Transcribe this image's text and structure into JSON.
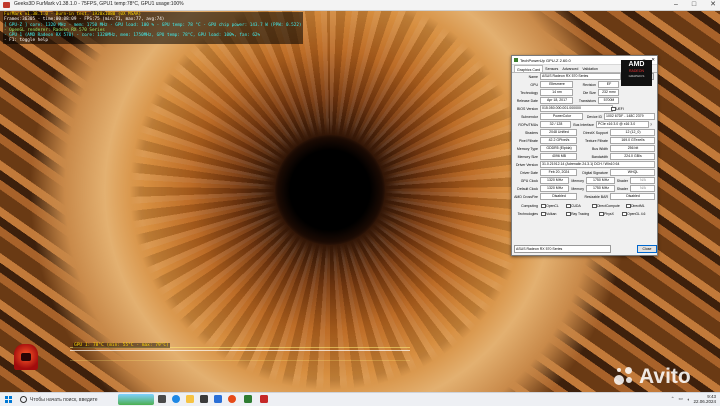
{
  "window_title": "Geeks3D FurMark v1.38.1.0 - 75FPS, GPU1 temp:78°C, GPU1 usage:100%",
  "window_controls": [
    "–",
    "□",
    "✕"
  ],
  "osd": [
    {
      "text": "FurMark v1.38.1.0 - Burn-in test, 1920x1080 (0X MSAA)",
      "color": "yellow"
    },
    {
      "text": "Frames:36305 - time:00:08:09 - FPS:75 (min:71, max:77, avg:74)",
      "color": "white"
    },
    {
      "text": "[ GPU-Z ] core: 1320 MHz - mem: 1750 MHz - GPU load: 100 % - GPU temp: 78 °C - GPU chip power: 143.7 W (PPW: 0.522)",
      "color": "cyan"
    },
    {
      "text": "- OpenGL renderer: Radeon RX 570 Series",
      "color": "green"
    },
    {
      "text": "- GPU 1 (AMD Radeon RX 570) - core: 1320MHz, mem: 1750MHz, GPU temp: 78°C, GPU load: 100%, fan: 62%",
      "color": "cyan"
    },
    {
      "text": "- F1: toggle help",
      "color": "white"
    }
  ],
  "graph_label": "GPU 1: 78°C (min: 55°C - max: 79°C)",
  "gpuz": {
    "title": "TechPowerUp GPU-Z 2.60.0",
    "tabs": [
      "Graphics Card",
      "Sensors",
      "Advanced",
      "Validation"
    ],
    "fields": {
      "name_label": "Name",
      "name": "ASUS Radeon RX 570 Series",
      "lookup": "Lookup",
      "gpu_label": "GPU",
      "gpu": "Ellesmere",
      "revision_label": "Revision",
      "revision": "EF",
      "technology_label": "Technology",
      "technology": "14 nm",
      "die_size_label": "Die Size",
      "die_size": "232 mm²",
      "release_label": "Release Date",
      "release": "Apr 18, 2017",
      "transistors_label": "Transistors",
      "transistors": "5700M",
      "bios_label": "BIOS Version",
      "bios": "015.050.000.001.000000",
      "uefi": "UEFI",
      "subvendor_label": "Subvendor",
      "subvendor": "PowerColor",
      "device_id_label": "Device ID",
      "device_id": "1002 67DF - 148C 2379",
      "rops_label": "ROPs/TMUs",
      "rops": "32 / 128",
      "bus_iface_label": "Bus Interface",
      "bus_iface": "PCIe x16 3.0 @ x16 3.0",
      "shaders_label": "Shaders",
      "shaders": "2048 Unified",
      "directx_label": "DirectX Support",
      "directx": "12 (12_0)",
      "pixel_label": "Pixel Fillrate",
      "pixel": "42.2 GPixel/s",
      "texture_label": "Texture Fillrate",
      "texture": "169.0 GTexel/s",
      "memtype_label": "Memory Type",
      "memtype": "GDDR5 (Elpida)",
      "buswidth_label": "Bus Width",
      "buswidth": "256 bit",
      "memsize_label": "Memory Size",
      "memsize": "4096 MB",
      "bandwidth_label": "Bandwidth",
      "bandwidth": "224.0 GB/s",
      "driver_label": "Driver Version",
      "driver": "31.0.21912.14 (Adrenalin 24.3.1) DCH / Win10 64",
      "driverdate_label": "Driver Date",
      "driverdate": "Feb 20, 2024",
      "digsig_label": "Digital Signature",
      "digsig": "WHQL",
      "gpuclock_label": "GPU Clock",
      "gpuclock": "1320 MHz",
      "mem_label": "Memory",
      "memclock": "1750 MHz",
      "shader_label": "Shader",
      "shader": "N/A",
      "defclock_label": "Default Clock",
      "defclock": "1320 MHz",
      "defmem": "1750 MHz",
      "defshader": "N/A",
      "crossfire_label": "AMD CrossFire",
      "crossfire": "Disabled",
      "rebar_label": "Resizable BAR",
      "rebar": "Disabled",
      "computing_label": "Computing",
      "technologies_label": "Technologies",
      "computing": [
        "OpenCL",
        "CUDA",
        "DirectCompute",
        "DirectML"
      ],
      "technologies": [
        "Vulkan",
        "Ray Tracing",
        "PhysX",
        "OpenGL 4.6"
      ]
    },
    "amd_logo": {
      "brand": "AMD",
      "line1": "RADEON",
      "line2": "GRAPHICS"
    },
    "selected_gpu": "ASUS Radeon RX 570 Series",
    "close": "Close"
  },
  "taskbar": {
    "search_placeholder": "Чтобы начать поиск, введите",
    "time": "9:43",
    "date": "22.06.2024"
  },
  "watermark": "Avito"
}
